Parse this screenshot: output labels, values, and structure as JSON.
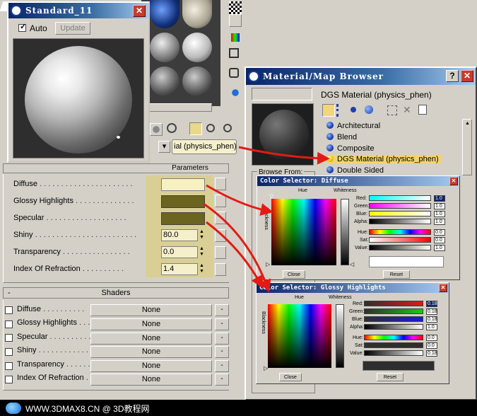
{
  "preview_window": {
    "title": "Standard_11",
    "auto_label": "Auto",
    "auto_checked": true,
    "update_label": "Update"
  },
  "material_type_dropdown": "ial (physics_phen)",
  "params_rollout": {
    "header": "Parameters",
    "rows": [
      {
        "label": "Diffuse",
        "color": "#f7f0c6"
      },
      {
        "label": "Glossy Highlights",
        "color": "#6b6320"
      },
      {
        "label": "Specular",
        "color": "#6b6320"
      },
      {
        "label": "Shiny",
        "value": "80.0"
      },
      {
        "label": "Transparency",
        "value": "0.0"
      },
      {
        "label": "Index Of Refraction",
        "value": "1.4"
      }
    ]
  },
  "shaders_rollout": {
    "collapse": "-",
    "header": "Shaders",
    "rows": [
      {
        "label": "Diffuse",
        "map": "None",
        "btn": "-"
      },
      {
        "label": "Glossy Highlights",
        "map": "None",
        "btn": "-"
      },
      {
        "label": "Specular",
        "map": "None",
        "btn": "-"
      },
      {
        "label": "Shiny",
        "map": "None",
        "btn": "-"
      },
      {
        "label": "Transparency",
        "map": "None",
        "btn": "-"
      },
      {
        "label": "Index Of Refraction",
        "map": "None",
        "btn": "-"
      }
    ]
  },
  "browser": {
    "title": "Material/Map Browser",
    "help": "?",
    "close": "X",
    "selected_name": "DGS Material (physics_phen)",
    "browse_from": "Browse From:",
    "items": [
      "Architectural",
      "Blend",
      "Composite",
      "DGS Material (physics_phen)",
      "Double Sided"
    ],
    "selected_index": 3
  },
  "color_selector_diffuse": {
    "title": "Color Selector: Diffuse",
    "hue": "Hue",
    "whiteness": "Whiteness",
    "blackness": "Blackness",
    "rgb": [
      {
        "label": "Red:",
        "value": "1.0"
      },
      {
        "label": "Green:",
        "value": "1.0"
      },
      {
        "label": "Blue:",
        "value": "1.0"
      },
      {
        "label": "Alpha:",
        "value": "1.0"
      }
    ],
    "hsv": [
      {
        "label": "Hue:",
        "value": "0.0"
      },
      {
        "label": "Sat:",
        "value": "0.0"
      },
      {
        "label": "Value:",
        "value": "1.0"
      }
    ],
    "close": "Close",
    "reset": "Reset"
  },
  "color_selector_glossy": {
    "title": "Color Selector: Glossy Highlights",
    "hue": "Hue",
    "whiteness": "Whiteness",
    "blackness": "Blackness",
    "rgb": [
      {
        "label": "Red:",
        "value": "0.18"
      },
      {
        "label": "Green:",
        "value": "0.18"
      },
      {
        "label": "Blue:",
        "value": "0.18"
      },
      {
        "label": "Alpha:",
        "value": "1.0"
      }
    ],
    "hsv": [
      {
        "label": "Hue:",
        "value": "0.0"
      },
      {
        "label": "Sat:",
        "value": "0.0"
      },
      {
        "label": "Value:",
        "value": "0.18"
      }
    ],
    "close": "Close",
    "reset": "Reset"
  },
  "watermark": "WWW.3DMAX8.CN @ 3D教程网",
  "colors": {
    "title_bar": "#0a246a",
    "annotation_arrow": "#e31b14",
    "highlight_band": "#d9cf94",
    "selected_item": "#f4d36b"
  }
}
